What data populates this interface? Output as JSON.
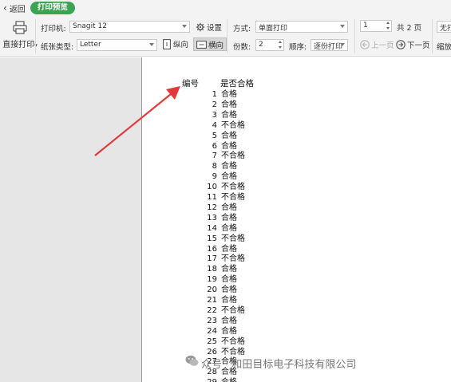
{
  "topbar": {
    "back_label": "返回",
    "tab_label": "打印预览"
  },
  "toolbar": {
    "direct_print_label": "直接打印",
    "printer_label": "打印机:",
    "printer_value": "Snagit 12",
    "settings_label": "设置",
    "paper_type_label": "纸张类型:",
    "paper_type_value": "Letter",
    "portrait_label": "纵向",
    "landscape_label": "横向",
    "mode_label": "方式:",
    "mode_value": "单面打印",
    "copies_label": "份数:",
    "copies_value": "2",
    "order_label": "顺序:",
    "order_value": "逐份打印",
    "page_value": "1",
    "total_pages": "共 2 页",
    "prev_page_label": "上一页",
    "next_page_label": "下一页",
    "no_label": "无打",
    "scale_label": "缩放"
  },
  "table": {
    "col_id_header": "编号",
    "col_result_header": "是否合格",
    "rows": [
      {
        "id": "1",
        "result": "合格"
      },
      {
        "id": "2",
        "result": "合格"
      },
      {
        "id": "3",
        "result": "合格"
      },
      {
        "id": "4",
        "result": "不合格"
      },
      {
        "id": "5",
        "result": "合格"
      },
      {
        "id": "6",
        "result": "合格"
      },
      {
        "id": "7",
        "result": "不合格"
      },
      {
        "id": "8",
        "result": "合格"
      },
      {
        "id": "9",
        "result": "合格"
      },
      {
        "id": "10",
        "result": "不合格"
      },
      {
        "id": "11",
        "result": "不合格"
      },
      {
        "id": "12",
        "result": "合格"
      },
      {
        "id": "13",
        "result": "合格"
      },
      {
        "id": "14",
        "result": "合格"
      },
      {
        "id": "15",
        "result": "不合格"
      },
      {
        "id": "16",
        "result": "合格"
      },
      {
        "id": "17",
        "result": "不合格"
      },
      {
        "id": "18",
        "result": "合格"
      },
      {
        "id": "19",
        "result": "合格"
      },
      {
        "id": "20",
        "result": "合格"
      },
      {
        "id": "21",
        "result": "合格"
      },
      {
        "id": "22",
        "result": "不合格"
      },
      {
        "id": "23",
        "result": "合格"
      },
      {
        "id": "24",
        "result": "合格"
      },
      {
        "id": "25",
        "result": "不合格"
      },
      {
        "id": "26",
        "result": "不合格"
      },
      {
        "id": "27",
        "result": "合格"
      },
      {
        "id": "28",
        "result": "合格"
      },
      {
        "id": "29",
        "result": "合格"
      }
    ]
  },
  "watermark": "众号 · 和田目标电子科技有限公司",
  "colors": {
    "accent": "#3aa452",
    "annotation_arrow": "#e23a3a"
  }
}
